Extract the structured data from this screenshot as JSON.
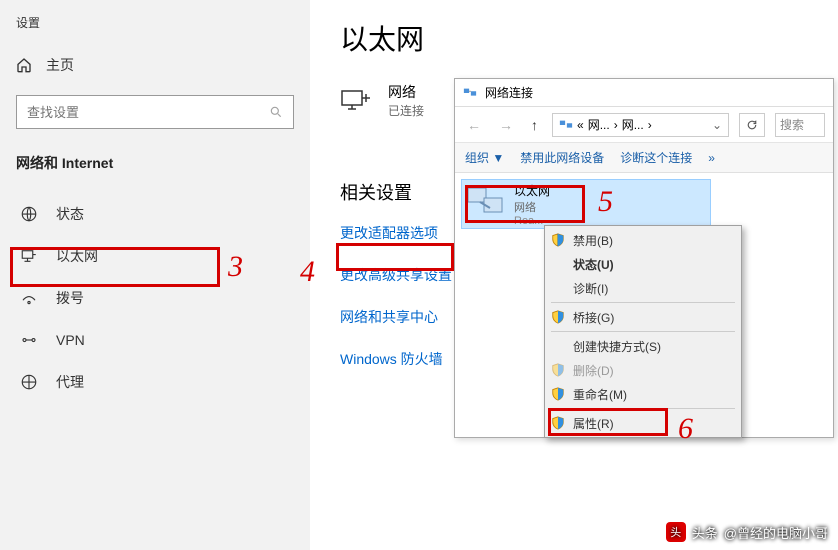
{
  "settings": {
    "window_title": "设置",
    "home_label": "主页",
    "search_placeholder": "查找设置",
    "category": "网络和 Internet",
    "nav": [
      {
        "label": "状态"
      },
      {
        "label": "以太网"
      },
      {
        "label": "拨号"
      },
      {
        "label": "VPN"
      },
      {
        "label": "代理"
      }
    ]
  },
  "main": {
    "heading": "以太网",
    "adapter_name": "网络",
    "adapter_status": "已连接",
    "related_heading": "相关设置",
    "links": [
      "更改适配器选项",
      "更改高级共享设置",
      "网络和共享中心",
      "Windows 防火墙"
    ]
  },
  "nc_window": {
    "title": "网络连接",
    "crumb1": "网...",
    "crumb2": "网...",
    "search_hint": "搜索",
    "toolbar": {
      "organize": "组织 ▼",
      "disable": "禁用此网络设备",
      "diagnose": "诊断这个连接",
      "more": "»"
    },
    "adapter": {
      "name": "以太网",
      "net": "网络",
      "desc": "Rea..."
    }
  },
  "context_menu": {
    "items": [
      {
        "label": "禁用(B)",
        "shield": true
      },
      {
        "label": "状态(U)",
        "bold": true
      },
      {
        "label": "诊断(I)"
      },
      {
        "sep": true
      },
      {
        "label": "桥接(G)",
        "shield": true
      },
      {
        "sep": true
      },
      {
        "label": "创建快捷方式(S)"
      },
      {
        "label": "删除(D)",
        "shield": true,
        "disabled": true
      },
      {
        "label": "重命名(M)",
        "shield": true
      },
      {
        "sep": true
      },
      {
        "label": "属性(R)",
        "shield": true
      }
    ]
  },
  "annotations": {
    "n3": "3",
    "n4": "4",
    "n5": "5",
    "n6": "6"
  },
  "watermark": {
    "prefix": "头条",
    "author": "@曾经的电脑小哥"
  }
}
